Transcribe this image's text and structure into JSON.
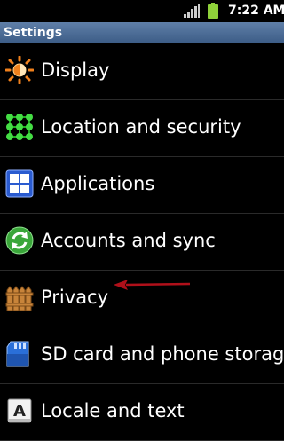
{
  "status_bar": {
    "time": "7:22 AM",
    "signal_icon": "signal-bars-icon",
    "battery_icon": "battery-icon"
  },
  "header": {
    "title": "Settings"
  },
  "settings": {
    "items": [
      {
        "label": "Display",
        "icon": "display-brightness-icon"
      },
      {
        "label": "Location and security",
        "icon": "location-security-icon"
      },
      {
        "label": "Applications",
        "icon": "applications-grid-icon"
      },
      {
        "label": "Accounts and sync",
        "icon": "sync-icon"
      },
      {
        "label": "Privacy",
        "icon": "privacy-fence-icon"
      },
      {
        "label": "SD card and phone storag",
        "icon": "sd-card-icon"
      },
      {
        "label": "Locale and text",
        "icon": "locale-text-icon"
      }
    ]
  },
  "annotation": {
    "arrow_icon": "red-arrow-icon",
    "color": "#b0101a"
  },
  "colors": {
    "title_bar": "#4a6a94",
    "background": "#000000",
    "display_icon": "#f0801c",
    "location_icon": "#33cc33",
    "applications_icon": "#2a5bd0",
    "sync_icon": "#3aa63a",
    "privacy_icon": "#c8843a",
    "sd_card_icon": "#2a6fd8"
  }
}
